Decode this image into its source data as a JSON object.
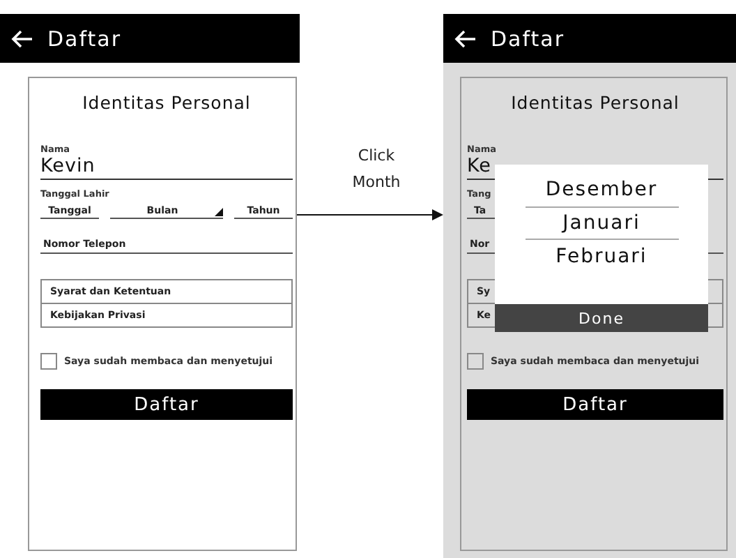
{
  "screens": [
    {
      "dimmed": false,
      "header": {
        "title": "Daftar"
      },
      "card": {
        "title": "Identitas Personal",
        "name": {
          "label": "Nama",
          "value": "Kevin"
        },
        "birth_date": {
          "label": "Tanggal Lahir",
          "fields": [
            {
              "placeholder": "Tanggal",
              "kind": "text"
            },
            {
              "placeholder": "Bulan",
              "kind": "dropdown"
            },
            {
              "placeholder": "Tahun",
              "kind": "text"
            }
          ]
        },
        "phone": {
          "placeholder": "Nomor Telepon"
        },
        "links": [
          "Syarat dan Ketentuan",
          "Kebijakan Privasi"
        ],
        "agreement": {
          "label": "Saya sudah membaca dan menyetujui",
          "checked": false
        },
        "submit": "Daftar"
      }
    },
    {
      "dimmed": true,
      "header": {
        "title": "Daftar"
      },
      "card": {
        "title": "Identitas Personal",
        "name": {
          "label": "Nama",
          "value": "Ke"
        },
        "birth_date": {
          "label": "Tang",
          "fields": [
            {
              "placeholder": "Ta",
              "kind": "text"
            }
          ]
        },
        "phone": {
          "placeholder": "Nor"
        },
        "links": [
          "Sy",
          "Ke"
        ],
        "agreement": {
          "label": "Saya sudah membaca dan menyetujui",
          "checked": false
        },
        "submit": "Daftar"
      },
      "picker": {
        "options": [
          {
            "label": "Desember",
            "selected": false
          },
          {
            "label": "Januari",
            "selected": true
          },
          {
            "label": "Februari",
            "selected": false
          }
        ],
        "done": "Done"
      }
    }
  ],
  "annotation": {
    "label": "Click Month"
  }
}
